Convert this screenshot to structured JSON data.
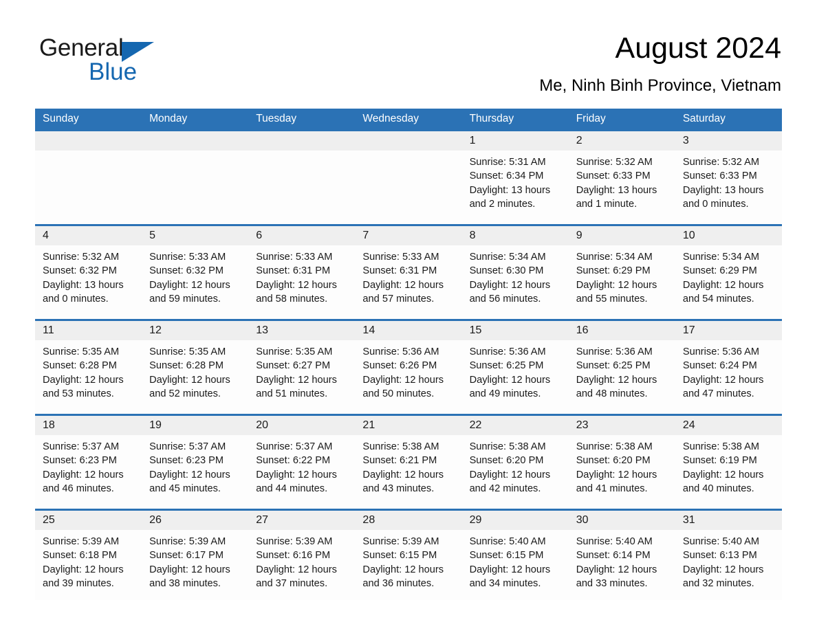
{
  "brand": {
    "name_part1": "General",
    "name_part2": "Blue",
    "accent_color": "#1567b0"
  },
  "header": {
    "title": "August 2024",
    "location": "Me, Ninh Binh Province, Vietnam",
    "header_bg_color": "#2b72b5",
    "daynum_bg_color": "#efefef"
  },
  "weekdays": [
    "Sunday",
    "Monday",
    "Tuesday",
    "Wednesday",
    "Thursday",
    "Friday",
    "Saturday"
  ],
  "weeks": [
    {
      "days": [
        {
          "num": "",
          "detail": ""
        },
        {
          "num": "",
          "detail": ""
        },
        {
          "num": "",
          "detail": ""
        },
        {
          "num": "",
          "detail": ""
        },
        {
          "num": "1",
          "detail": "Sunrise: 5:31 AM\nSunset: 6:34 PM\nDaylight: 13 hours\nand 2 minutes."
        },
        {
          "num": "2",
          "detail": "Sunrise: 5:32 AM\nSunset: 6:33 PM\nDaylight: 13 hours\nand 1 minute."
        },
        {
          "num": "3",
          "detail": "Sunrise: 5:32 AM\nSunset: 6:33 PM\nDaylight: 13 hours\nand 0 minutes."
        }
      ]
    },
    {
      "days": [
        {
          "num": "4",
          "detail": "Sunrise: 5:32 AM\nSunset: 6:32 PM\nDaylight: 13 hours\nand 0 minutes."
        },
        {
          "num": "5",
          "detail": "Sunrise: 5:33 AM\nSunset: 6:32 PM\nDaylight: 12 hours\nand 59 minutes."
        },
        {
          "num": "6",
          "detail": "Sunrise: 5:33 AM\nSunset: 6:31 PM\nDaylight: 12 hours\nand 58 minutes."
        },
        {
          "num": "7",
          "detail": "Sunrise: 5:33 AM\nSunset: 6:31 PM\nDaylight: 12 hours\nand 57 minutes."
        },
        {
          "num": "8",
          "detail": "Sunrise: 5:34 AM\nSunset: 6:30 PM\nDaylight: 12 hours\nand 56 minutes."
        },
        {
          "num": "9",
          "detail": "Sunrise: 5:34 AM\nSunset: 6:29 PM\nDaylight: 12 hours\nand 55 minutes."
        },
        {
          "num": "10",
          "detail": "Sunrise: 5:34 AM\nSunset: 6:29 PM\nDaylight: 12 hours\nand 54 minutes."
        }
      ]
    },
    {
      "days": [
        {
          "num": "11",
          "detail": "Sunrise: 5:35 AM\nSunset: 6:28 PM\nDaylight: 12 hours\nand 53 minutes."
        },
        {
          "num": "12",
          "detail": "Sunrise: 5:35 AM\nSunset: 6:28 PM\nDaylight: 12 hours\nand 52 minutes."
        },
        {
          "num": "13",
          "detail": "Sunrise: 5:35 AM\nSunset: 6:27 PM\nDaylight: 12 hours\nand 51 minutes."
        },
        {
          "num": "14",
          "detail": "Sunrise: 5:36 AM\nSunset: 6:26 PM\nDaylight: 12 hours\nand 50 minutes."
        },
        {
          "num": "15",
          "detail": "Sunrise: 5:36 AM\nSunset: 6:25 PM\nDaylight: 12 hours\nand 49 minutes."
        },
        {
          "num": "16",
          "detail": "Sunrise: 5:36 AM\nSunset: 6:25 PM\nDaylight: 12 hours\nand 48 minutes."
        },
        {
          "num": "17",
          "detail": "Sunrise: 5:36 AM\nSunset: 6:24 PM\nDaylight: 12 hours\nand 47 minutes."
        }
      ]
    },
    {
      "days": [
        {
          "num": "18",
          "detail": "Sunrise: 5:37 AM\nSunset: 6:23 PM\nDaylight: 12 hours\nand 46 minutes."
        },
        {
          "num": "19",
          "detail": "Sunrise: 5:37 AM\nSunset: 6:23 PM\nDaylight: 12 hours\nand 45 minutes."
        },
        {
          "num": "20",
          "detail": "Sunrise: 5:37 AM\nSunset: 6:22 PM\nDaylight: 12 hours\nand 44 minutes."
        },
        {
          "num": "21",
          "detail": "Sunrise: 5:38 AM\nSunset: 6:21 PM\nDaylight: 12 hours\nand 43 minutes."
        },
        {
          "num": "22",
          "detail": "Sunrise: 5:38 AM\nSunset: 6:20 PM\nDaylight: 12 hours\nand 42 minutes."
        },
        {
          "num": "23",
          "detail": "Sunrise: 5:38 AM\nSunset: 6:20 PM\nDaylight: 12 hours\nand 41 minutes."
        },
        {
          "num": "24",
          "detail": "Sunrise: 5:38 AM\nSunset: 6:19 PM\nDaylight: 12 hours\nand 40 minutes."
        }
      ]
    },
    {
      "days": [
        {
          "num": "25",
          "detail": "Sunrise: 5:39 AM\nSunset: 6:18 PM\nDaylight: 12 hours\nand 39 minutes."
        },
        {
          "num": "26",
          "detail": "Sunrise: 5:39 AM\nSunset: 6:17 PM\nDaylight: 12 hours\nand 38 minutes."
        },
        {
          "num": "27",
          "detail": "Sunrise: 5:39 AM\nSunset: 6:16 PM\nDaylight: 12 hours\nand 37 minutes."
        },
        {
          "num": "28",
          "detail": "Sunrise: 5:39 AM\nSunset: 6:15 PM\nDaylight: 12 hours\nand 36 minutes."
        },
        {
          "num": "29",
          "detail": "Sunrise: 5:40 AM\nSunset: 6:15 PM\nDaylight: 12 hours\nand 34 minutes."
        },
        {
          "num": "30",
          "detail": "Sunrise: 5:40 AM\nSunset: 6:14 PM\nDaylight: 12 hours\nand 33 minutes."
        },
        {
          "num": "31",
          "detail": "Sunrise: 5:40 AM\nSunset: 6:13 PM\nDaylight: 12 hours\nand 32 minutes."
        }
      ]
    }
  ]
}
